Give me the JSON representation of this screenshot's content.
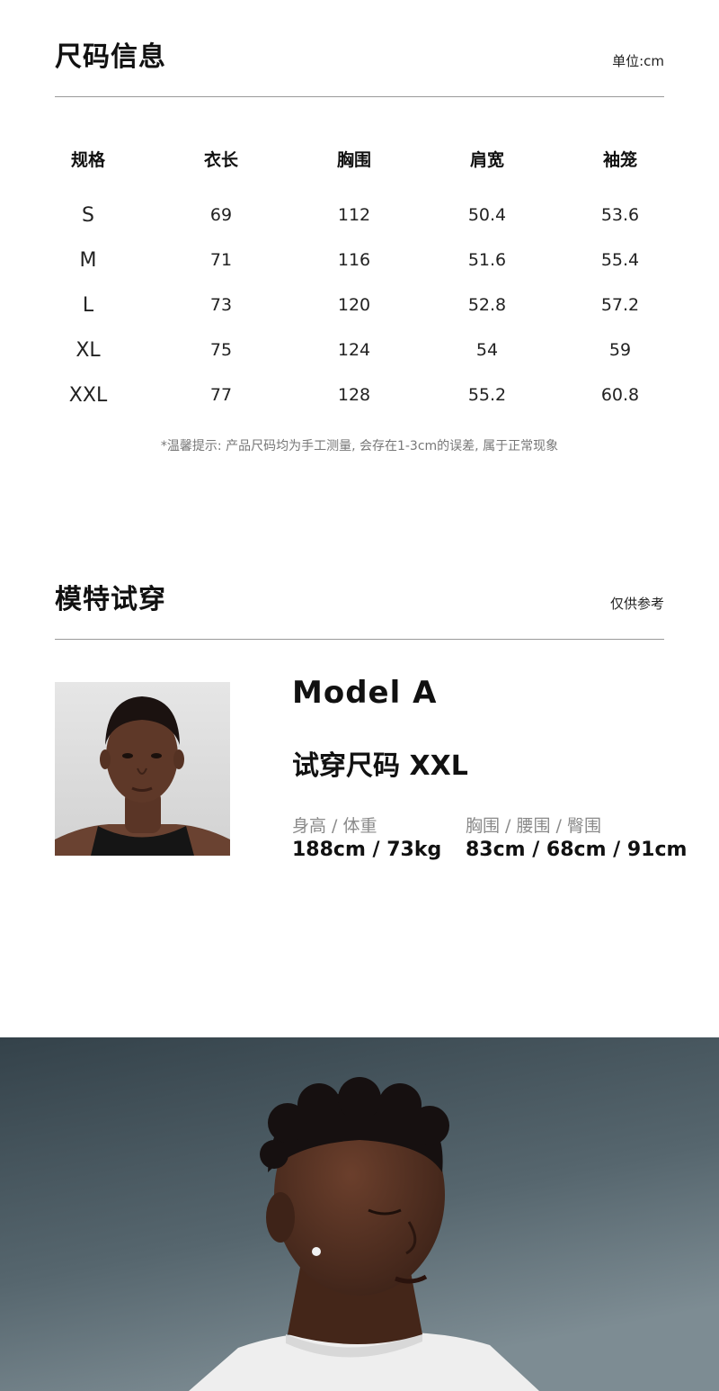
{
  "size_info": {
    "title": "尺码信息",
    "unit": "单位:cm",
    "headers": [
      "规格",
      "衣长",
      "胸围",
      "肩宽",
      "袖笼"
    ],
    "rows": [
      [
        "S",
        "69",
        "112",
        "50.4",
        "53.6"
      ],
      [
        "M",
        "71",
        "116",
        "51.6",
        "55.4"
      ],
      [
        "L",
        "73",
        "120",
        "52.8",
        "57.2"
      ],
      [
        "XL",
        "75",
        "124",
        "54",
        "59"
      ],
      [
        "XXL",
        "77",
        "128",
        "55.2",
        "60.8"
      ]
    ],
    "tip": "*温馨提示: 产品尺码均为手工测量, 会存在1-3cm的误差, 属于正常现象"
  },
  "model_section": {
    "title": "模特试穿",
    "note": "仅供参考",
    "model": {
      "name": "Model A",
      "try_size": "试穿尺码 XXL",
      "stat1_label": "身高 / 体重",
      "stat1_value": "188cm / 73kg",
      "stat2_label": "胸围 / 腰围 / 臀围",
      "stat2_value": "83cm / 68cm / 91cm"
    }
  },
  "colors": {
    "rule": "#9a9a9a",
    "hero_bg_top": "#36434a",
    "hero_bg_bottom": "#6b7b83"
  }
}
